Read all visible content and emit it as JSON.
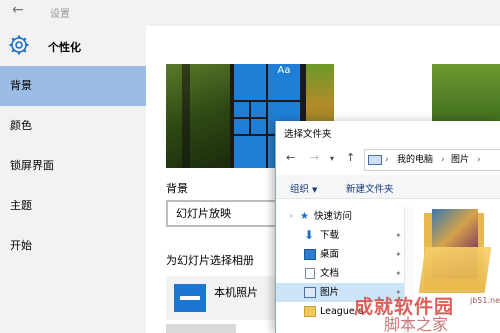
{
  "window": {
    "title": "设置"
  },
  "sidebar": {
    "header": "个性化",
    "items": [
      {
        "label": "背景"
      },
      {
        "label": "颜色"
      },
      {
        "label": "锁屏界面"
      },
      {
        "label": "主题"
      },
      {
        "label": "开始"
      }
    ]
  },
  "main": {
    "preview_tile_text": "Aa",
    "background_label": "背景",
    "background_value": "幻灯片放映",
    "album_label": "为幻灯片选择相册",
    "album_item": "本机照片"
  },
  "dialog": {
    "title": "选择文件夹",
    "address": {
      "pc": "我的电脑",
      "folder": "图片"
    },
    "toolbar": {
      "organize": "组织",
      "new_folder": "新建文件夹"
    },
    "tree": [
      {
        "label": "快速访问",
        "icon": "star-icon",
        "pinned": false
      },
      {
        "label": "下载",
        "icon": "download-icon",
        "pinned": true
      },
      {
        "label": "桌面",
        "icon": "desktop-icon",
        "pinned": true
      },
      {
        "label": "文档",
        "icon": "document-icon",
        "pinned": true
      },
      {
        "label": "图片",
        "icon": "picture-icon",
        "pinned": true
      },
      {
        "label": "League o",
        "icon": "folder-icon",
        "pinned": false
      }
    ]
  },
  "watermark": {
    "line1": "成就软件园",
    "line2": "脚本之家",
    "line3": "jb51.net"
  },
  "colors": {
    "accent": "#1f7fd6",
    "active_nav": "#9cbde3",
    "watermark": "#d9534f"
  }
}
